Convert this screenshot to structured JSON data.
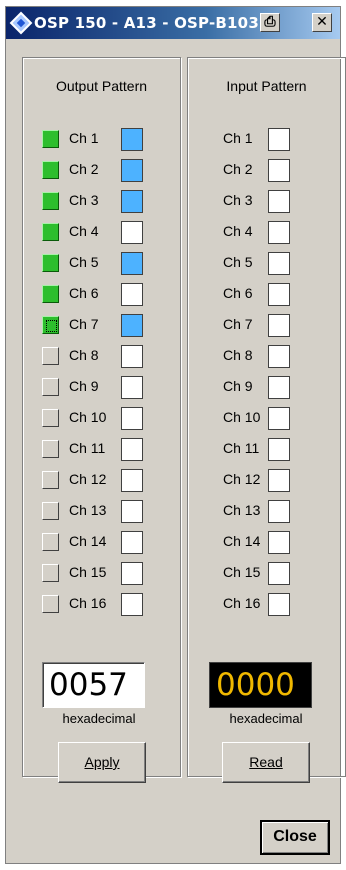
{
  "window": {
    "title": "OSP 150 - A13 - OSP-B103",
    "print_icon": "⎙",
    "close_icon": "✕"
  },
  "output": {
    "title": "Output Pattern",
    "channels": [
      {
        "label": "Ch 1",
        "led_on": true,
        "bit_on": true
      },
      {
        "label": "Ch 2",
        "led_on": true,
        "bit_on": true
      },
      {
        "label": "Ch 3",
        "led_on": true,
        "bit_on": true
      },
      {
        "label": "Ch 4",
        "led_on": true,
        "bit_on": false
      },
      {
        "label": "Ch 5",
        "led_on": true,
        "bit_on": true
      },
      {
        "label": "Ch 6",
        "led_on": true,
        "bit_on": false
      },
      {
        "label": "Ch 7",
        "led_on": true,
        "bit_on": true,
        "focused": true
      },
      {
        "label": "Ch 8",
        "led_on": false,
        "bit_on": false
      },
      {
        "label": "Ch 9",
        "led_on": false,
        "bit_on": false
      },
      {
        "label": "Ch 10",
        "led_on": false,
        "bit_on": false
      },
      {
        "label": "Ch 11",
        "led_on": false,
        "bit_on": false
      },
      {
        "label": "Ch 12",
        "led_on": false,
        "bit_on": false
      },
      {
        "label": "Ch 13",
        "led_on": false,
        "bit_on": false
      },
      {
        "label": "Ch 14",
        "led_on": false,
        "bit_on": false
      },
      {
        "label": "Ch 15",
        "led_on": false,
        "bit_on": false
      },
      {
        "label": "Ch 16",
        "led_on": false,
        "bit_on": false
      }
    ],
    "hex_value": "0057",
    "hex_label": "hexadecimal",
    "button": "Apply"
  },
  "input": {
    "title": "Input Pattern",
    "channels": [
      {
        "label": "Ch 1",
        "bit_on": false
      },
      {
        "label": "Ch 2",
        "bit_on": false
      },
      {
        "label": "Ch 3",
        "bit_on": false
      },
      {
        "label": "Ch 4",
        "bit_on": false
      },
      {
        "label": "Ch 5",
        "bit_on": false
      },
      {
        "label": "Ch 6",
        "bit_on": false
      },
      {
        "label": "Ch 7",
        "bit_on": false
      },
      {
        "label": "Ch 8",
        "bit_on": false
      },
      {
        "label": "Ch 9",
        "bit_on": false
      },
      {
        "label": "Ch 10",
        "bit_on": false
      },
      {
        "label": "Ch 11",
        "bit_on": false
      },
      {
        "label": "Ch 12",
        "bit_on": false
      },
      {
        "label": "Ch 13",
        "bit_on": false
      },
      {
        "label": "Ch 14",
        "bit_on": false
      },
      {
        "label": "Ch 15",
        "bit_on": false
      },
      {
        "label": "Ch 16",
        "bit_on": false
      }
    ],
    "hex_value": "0000",
    "hex_label": "hexadecimal",
    "button": "Read"
  },
  "close_button": "Close",
  "colors": {
    "led_on": "#2dbe2d",
    "bit_on": "#4db2ff",
    "input_hex_text": "#f0b800",
    "title_bar": "#0a246a"
  }
}
